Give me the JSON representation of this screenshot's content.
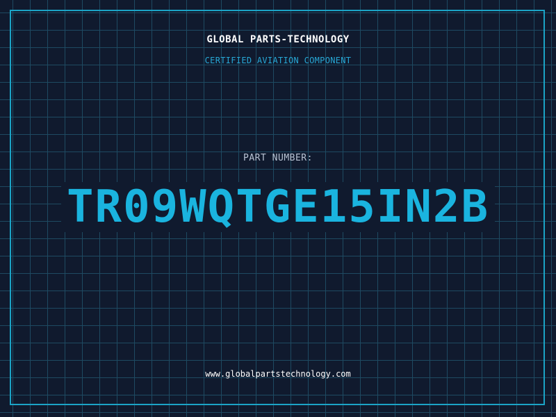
{
  "document": {
    "company_name": "GLOBAL PARTS-TECHNOLOGY",
    "subtitle": "CERTIFIED AVIATION COMPONENT",
    "part_number_label": "PART NUMBER:",
    "part_number": "TR09WQTGE15IN2B",
    "website": "www.globalpartstechnology.com"
  },
  "colors": {
    "background": "#101a2e",
    "grid": "#1e4a62",
    "frame": "#1ba3c6",
    "accent": "#1ab4df",
    "subtitle": "#27a8d6",
    "label": "#b9c4d4",
    "text": "#ffffff"
  }
}
